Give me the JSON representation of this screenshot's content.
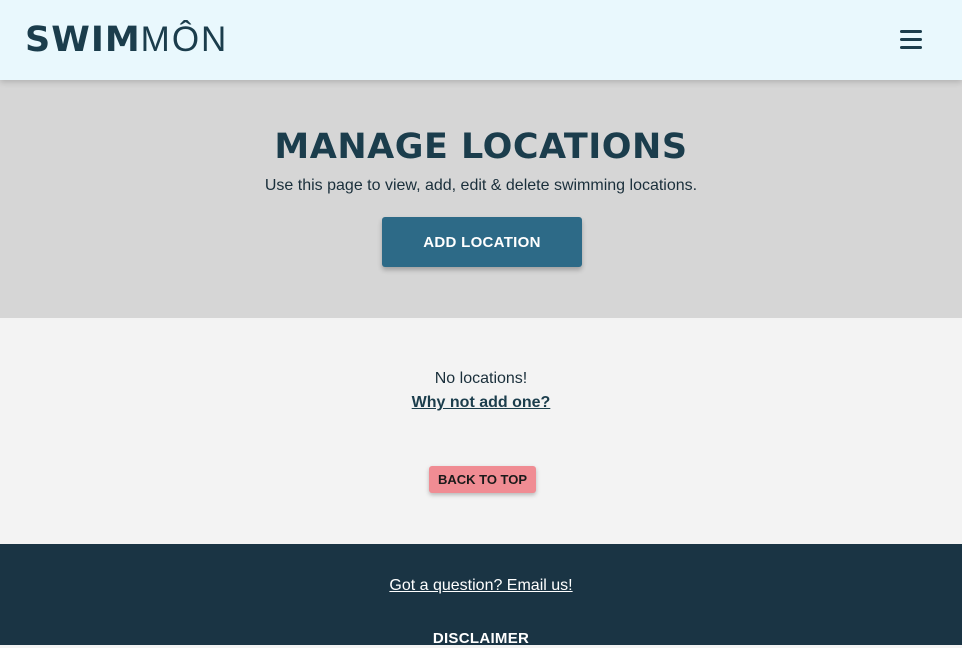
{
  "header": {
    "logo_bold": "SWIM",
    "logo_light": "MÔN",
    "menu_icon": "hamburger-menu-icon"
  },
  "hero": {
    "title": "MANAGE LOCATIONS",
    "subtitle": "Use this page to view, add, edit & delete swimming locations.",
    "add_button_label": "ADD LOCATION"
  },
  "main": {
    "empty_message": "No locations!",
    "empty_link": "Why not add one?",
    "back_to_top_label": "BACK TO TOP"
  },
  "footer": {
    "contact_link": "Got a question? Email us!",
    "disclaimer_heading": "DISCLAIMER"
  },
  "colors": {
    "header_bg": "#e9f8fd",
    "hero_bg": "#d6d6d6",
    "main_bg": "#f3f3f3",
    "footer_bg": "#1a3444",
    "primary_button": "#2d6a87",
    "back_to_top_button": "#f08c93",
    "brand_text": "#1b3d4c"
  }
}
